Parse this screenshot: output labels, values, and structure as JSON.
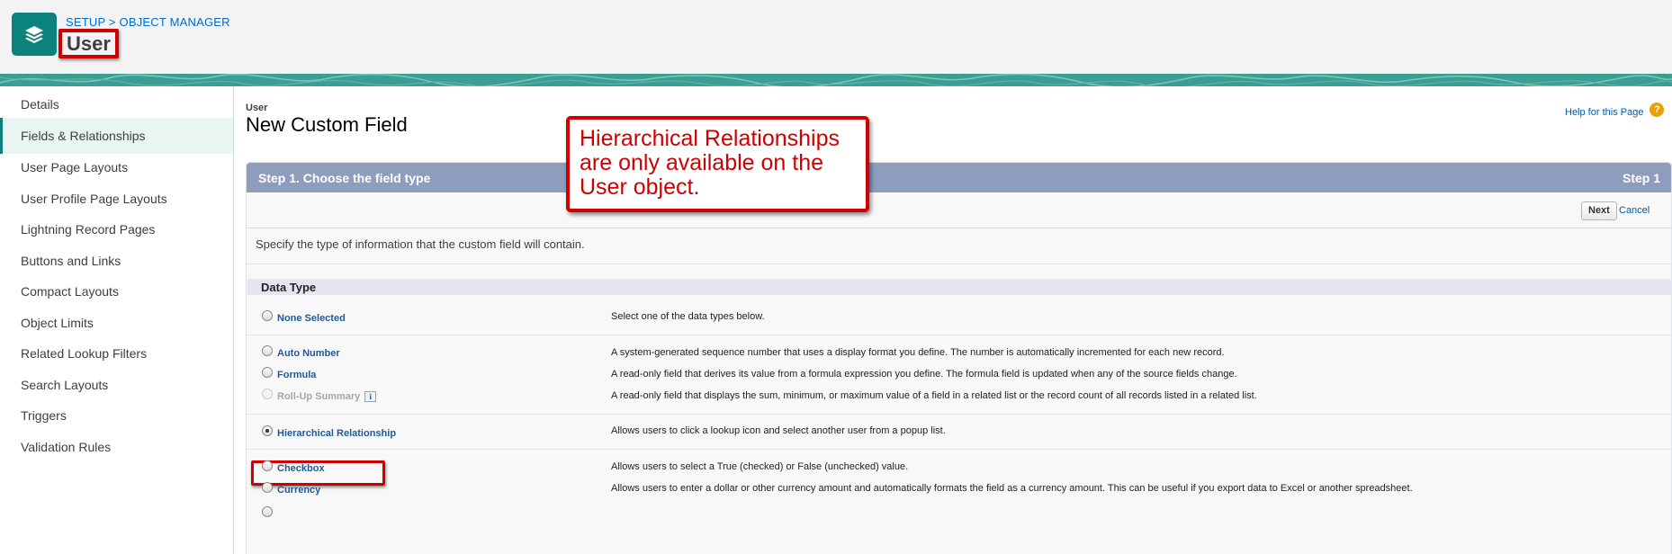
{
  "header": {
    "breadcrumb": [
      "SETUP",
      "OBJECT MANAGER"
    ],
    "breadcrumb_sep": ">",
    "title": "User",
    "app_icon": "layers-icon",
    "accent_color": "#0b827c"
  },
  "sidebar": {
    "items": [
      {
        "label": "Details"
      },
      {
        "label": "Fields & Relationships",
        "active": true
      },
      {
        "label": "User Page Layouts"
      },
      {
        "label": "User Profile Page Layouts"
      },
      {
        "label": "Lightning Record Pages"
      },
      {
        "label": "Buttons and Links"
      },
      {
        "label": "Compact Layouts"
      },
      {
        "label": "Object Limits"
      },
      {
        "label": "Related Lookup Filters"
      },
      {
        "label": "Search Layouts"
      },
      {
        "label": "Triggers"
      },
      {
        "label": "Validation Rules"
      }
    ]
  },
  "main": {
    "object_label": "User",
    "title": "New Custom Field",
    "help_link": "Help for this Page",
    "help_icon": "question-icon"
  },
  "step": {
    "title": "Step 1. Choose the field type",
    "number": "Step 1",
    "next_label": "Next",
    "cancel_label": "Cancel",
    "instructions": "Specify the type of information that the custom field will contain."
  },
  "data_type": {
    "header": "Data Type",
    "options": [
      {
        "label": "None Selected",
        "description": "Select one of the data types below.",
        "checked": false,
        "disabled": false
      },
      {
        "label": "Auto Number",
        "description": "A system-generated sequence number that uses a display format you define. The number is automatically incremented for each new record.",
        "checked": false,
        "disabled": false
      },
      {
        "label": "Formula",
        "description": "A read-only field that derives its value from a formula expression you define. The formula field is updated when any of the source fields change.",
        "checked": false,
        "disabled": false
      },
      {
        "label": "Roll-Up Summary",
        "description": "A read-only field that displays the sum, minimum, or maximum value of a field in a related list or the record count of all records listed in a related list.",
        "checked": false,
        "disabled": true,
        "info_icon": "info-icon"
      },
      {
        "label": "Hierarchical Relationship",
        "description": "Allows users to click a lookup icon and select another user from a popup list.",
        "checked": true,
        "disabled": false
      },
      {
        "label": "Checkbox",
        "description": "Allows users to select a True (checked) or False (unchecked) value.",
        "checked": false,
        "disabled": false
      },
      {
        "label": "Currency",
        "description": "Allows users to enter a dollar or other currency amount and automatically formats the field as a currency amount. This can be useful if you export data to Excel or another spreadsheet.",
        "checked": false,
        "disabled": false
      }
    ]
  },
  "callout": {
    "text": "Hierarchical Relationships are only available on the User object.",
    "color": "#d00000"
  }
}
